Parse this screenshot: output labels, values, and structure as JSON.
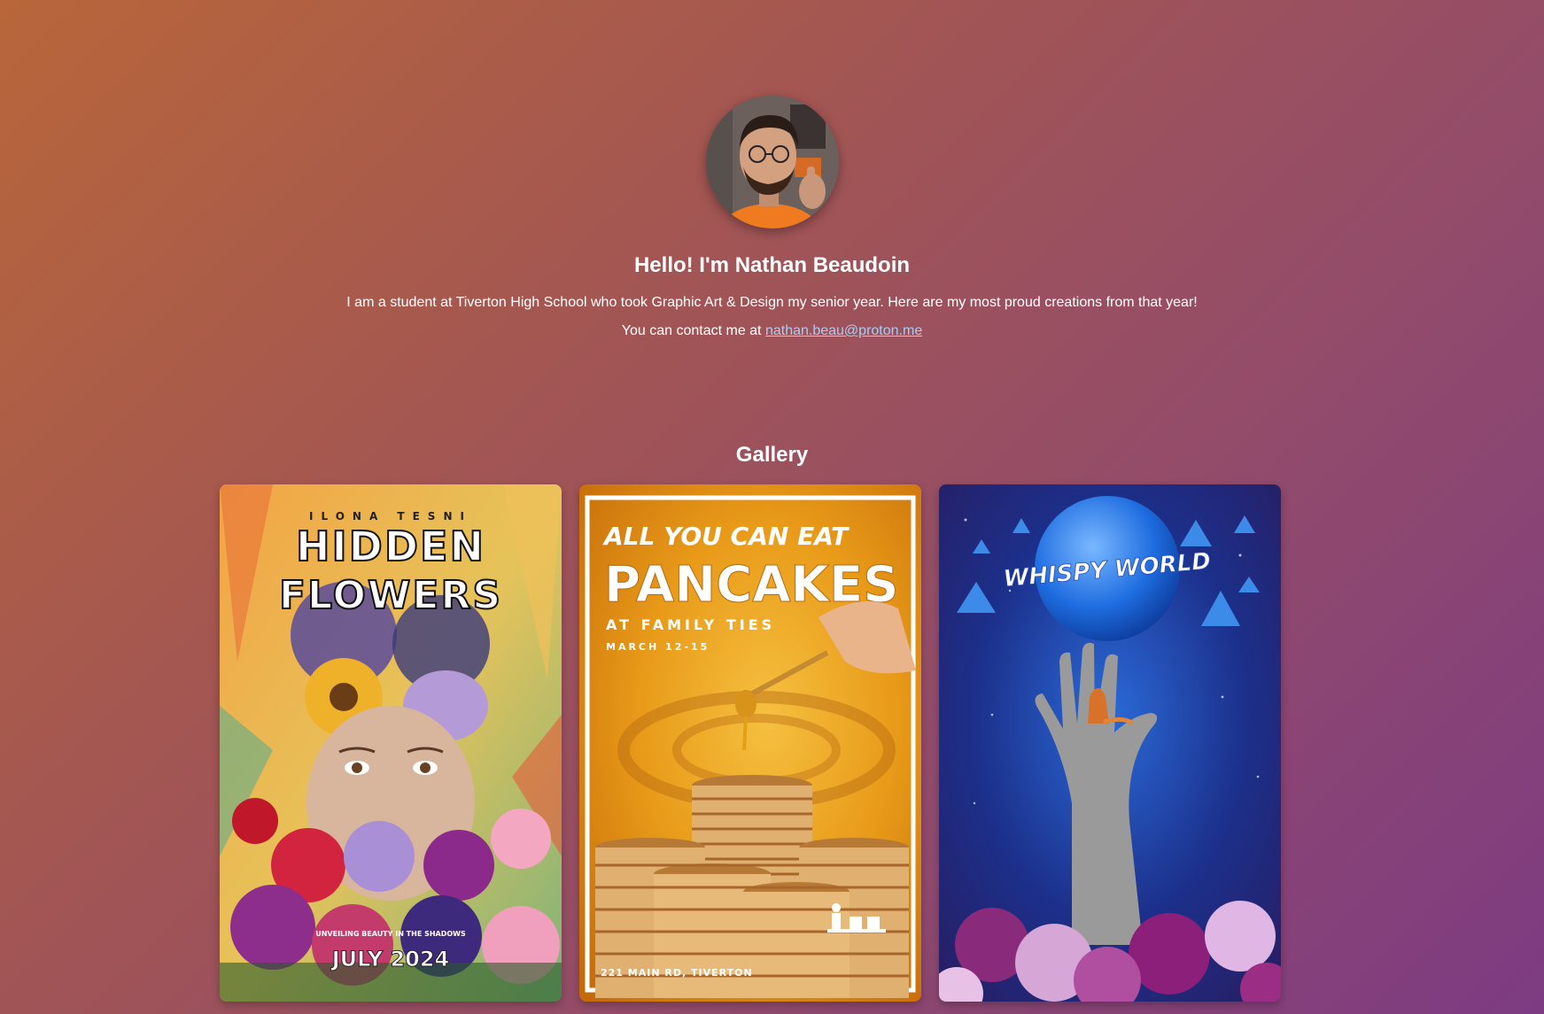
{
  "profile": {
    "avatar_alt": "Profile photo",
    "heading": "Hello! I'm Nathan Beaudoin",
    "intro": "I am a student at Tiverton High School who took Graphic Art & Design my senior year. Here are my most proud creations from that year!",
    "contact_prefix": "You can contact me at ",
    "email": "nathan.beau@proton.me",
    "email_href": "mailto:nathan.beau@proton.me"
  },
  "gallery": {
    "title": "Gallery",
    "items": [
      {
        "author": "ILONA TESNI",
        "title_line1": "HIDDEN",
        "title_line2": "FLOWERS",
        "tagline": "UNVEILING BEAUTY IN THE SHADOWS",
        "date": "JULY 2024"
      },
      {
        "headline": "ALL YOU CAN EAT",
        "title": "PANCAKES",
        "venue": "AT FAMILY TIES",
        "dates": "MARCH 12-15",
        "address": "221 MAIN RD, TIVERTON"
      },
      {
        "title": "WHISPY WORLD"
      }
    ]
  },
  "colors": {
    "link": "#a8cdf5",
    "text": "#ffffff"
  }
}
